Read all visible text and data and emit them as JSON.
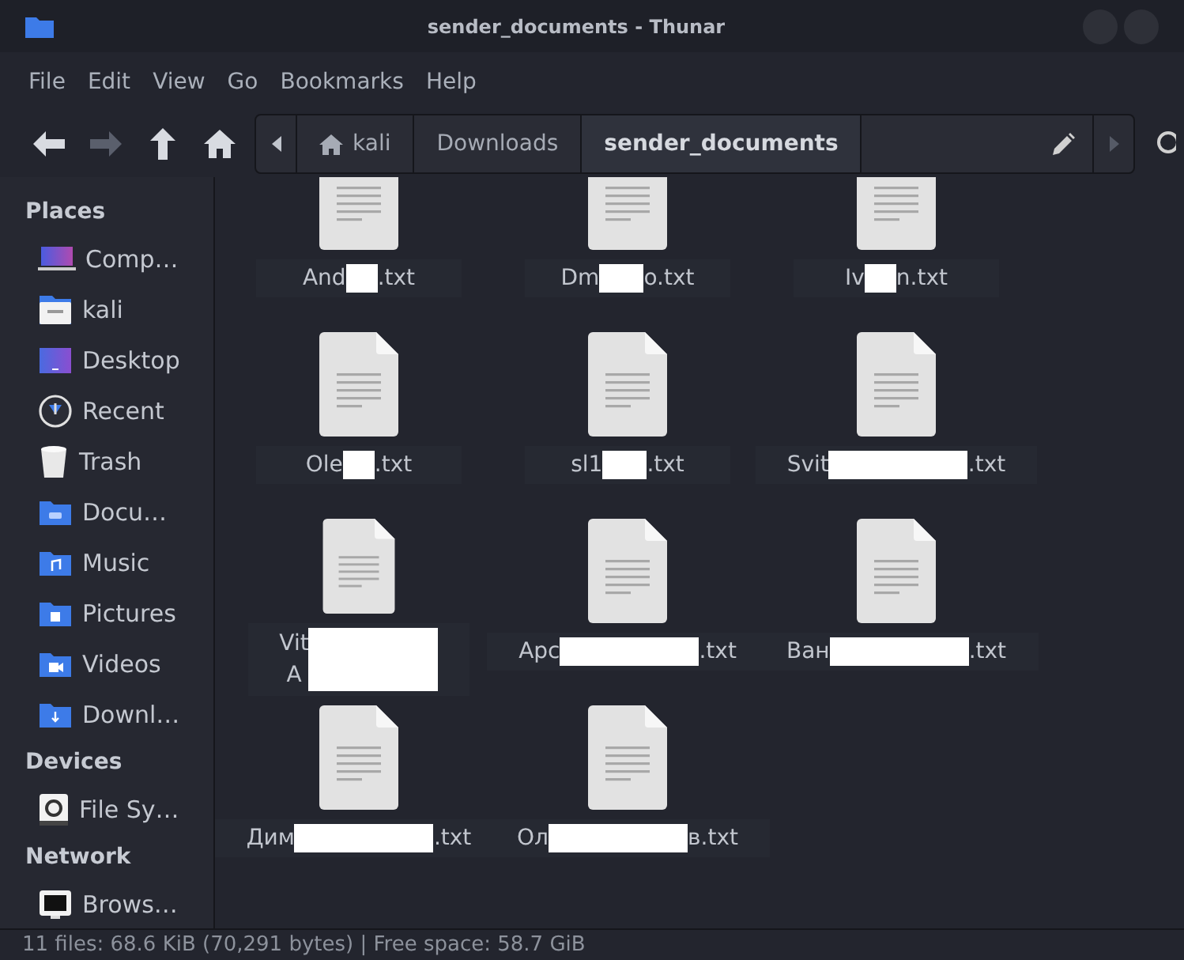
{
  "window": {
    "title": "sender_documents - Thunar"
  },
  "menu": [
    "File",
    "Edit",
    "View",
    "Go",
    "Bookmarks",
    "Help"
  ],
  "toolbar": {
    "back_disabled": false,
    "forward_disabled": true
  },
  "path": [
    {
      "label": "kali",
      "kind": "home",
      "selected": false
    },
    {
      "label": "Downloads",
      "kind": "folder",
      "selected": false
    },
    {
      "label": "sender_documents",
      "kind": "folder",
      "selected": true
    }
  ],
  "sidebar": [
    {
      "heading": "Places",
      "items": [
        {
          "label": "Comp…",
          "kind": "computer"
        },
        {
          "label": "kali",
          "kind": "home"
        },
        {
          "label": "Desktop",
          "kind": "desktop"
        },
        {
          "label": "Recent",
          "kind": "recent"
        },
        {
          "label": "Trash",
          "kind": "trash"
        },
        {
          "label": "Docu…",
          "kind": "documents"
        },
        {
          "label": "Music",
          "kind": "music"
        },
        {
          "label": "Pictures",
          "kind": "pictures"
        },
        {
          "label": "Videos",
          "kind": "videos"
        },
        {
          "label": "Downl…",
          "kind": "downloads"
        }
      ]
    },
    {
      "heading": "Devices",
      "items": [
        {
          "label": "File Sy…",
          "kind": "drive"
        }
      ]
    },
    {
      "heading": "Network",
      "items": [
        {
          "label": "Brows…",
          "kind": "network"
        }
      ]
    }
  ],
  "files": [
    {
      "before": "And",
      "after": ".txt",
      "kind": "small"
    },
    {
      "before": "Dm",
      "after": "o.txt",
      "kind": "medium"
    },
    {
      "before": "Iv",
      "after": "n.txt",
      "kind": "small"
    },
    {
      "before": "Ole",
      "after": ".txt",
      "kind": "small"
    },
    {
      "before": "sl1",
      "after": ".txt",
      "kind": "medium"
    },
    {
      "before": "Svit",
      "after": ".txt",
      "kind": "large"
    },
    {
      "before": "Vit",
      "after": "A",
      "kind": "block"
    },
    {
      "before": "Арс",
      "after": ".txt",
      "kind": "large"
    },
    {
      "before": "Ван",
      "after": ".txt",
      "kind": "large"
    },
    {
      "before": "Дим",
      "after": ".txt",
      "kind": "large"
    },
    {
      "before": "Ол",
      "after": "в.txt",
      "kind": "large"
    }
  ],
  "status_bar": "11 files: 68.6 KiB (70,291 bytes) | Free space: 58.7 GiB"
}
